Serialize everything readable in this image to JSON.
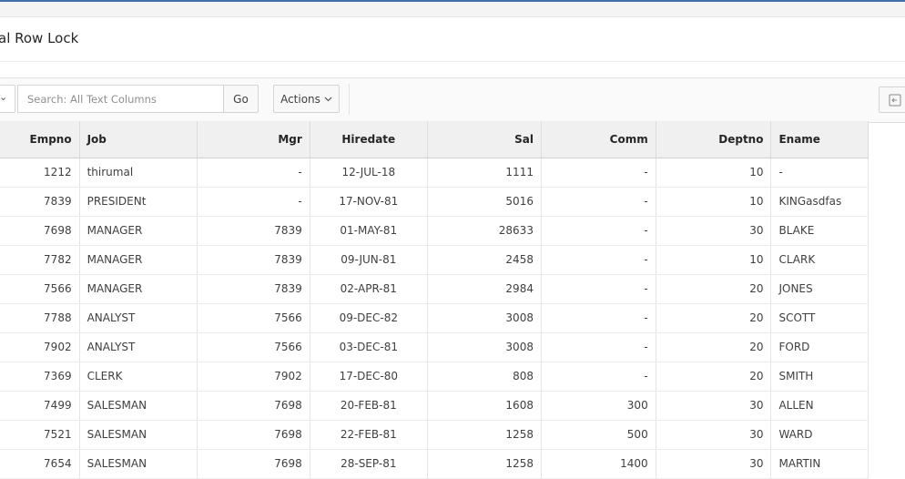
{
  "region": {
    "title": "al Row Lock"
  },
  "toolbar": {
    "search_placeholder": "Search: All Text Columns",
    "go_label": "Go",
    "actions_label": "Actions"
  },
  "table": {
    "columns": [
      "Empno",
      "Job",
      "Mgr",
      "Hiredate",
      "Sal",
      "Comm",
      "Deptno",
      "Ename"
    ],
    "rows": [
      [
        "1212",
        "thirumal",
        "-",
        "12-JUL-18",
        "1111",
        "-",
        "10",
        "-"
      ],
      [
        "7839",
        "PRESIDENt",
        "-",
        "17-NOV-81",
        "5016",
        "-",
        "10",
        "KINGasdfas"
      ],
      [
        "7698",
        "MANAGER",
        "7839",
        "01-MAY-81",
        "28633",
        "-",
        "30",
        "BLAKE"
      ],
      [
        "7782",
        "MANAGER",
        "7839",
        "09-JUN-81",
        "2458",
        "-",
        "10",
        "CLARK"
      ],
      [
        "7566",
        "MANAGER",
        "7839",
        "02-APR-81",
        "2984",
        "-",
        "20",
        "JONES"
      ],
      [
        "7788",
        "ANALYST",
        "7566",
        "09-DEC-82",
        "3008",
        "-",
        "20",
        "SCOTT"
      ],
      [
        "7902",
        "ANALYST",
        "7566",
        "03-DEC-81",
        "3008",
        "-",
        "20",
        "FORD"
      ],
      [
        "7369",
        "CLERK",
        "7902",
        "17-DEC-80",
        "808",
        "-",
        "20",
        "SMITH"
      ],
      [
        "7499",
        "SALESMAN",
        "7698",
        "20-FEB-81",
        "1608",
        "300",
        "30",
        "ALLEN"
      ],
      [
        "7521",
        "SALESMAN",
        "7698",
        "22-FEB-81",
        "1258",
        "500",
        "30",
        "WARD"
      ],
      [
        "7654",
        "SALESMAN",
        "7698",
        "28-SEP-81",
        "1258",
        "1400",
        "30",
        "MARTIN"
      ]
    ]
  },
  "colors": {
    "link": "#1a73b8",
    "accent": "#3f6fa6"
  },
  "icons": {
    "select_chevron": "chevron-down-icon",
    "actions_chevron": "chevron-down-icon",
    "right_button": "export-icon"
  }
}
